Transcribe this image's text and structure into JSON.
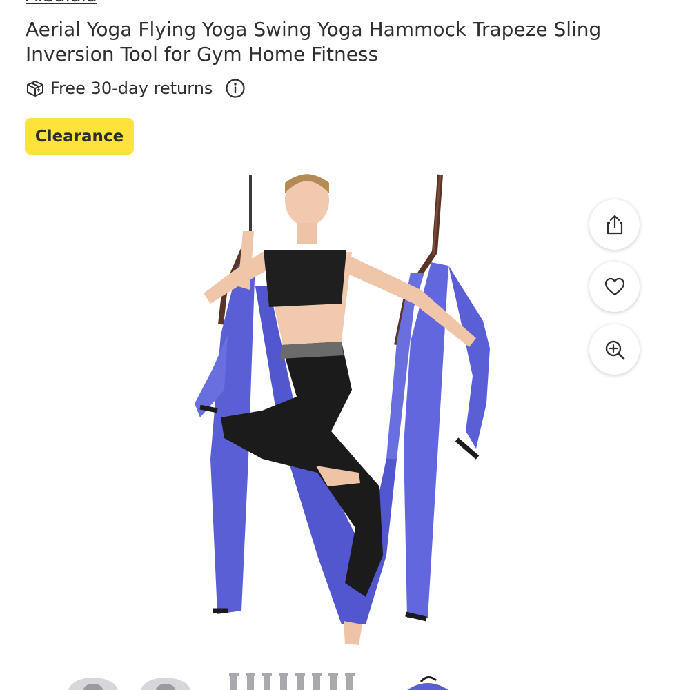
{
  "product": {
    "brand": "Aibaiaia",
    "title": "Aerial Yoga Flying Yoga Swing Yoga Hammock Trapeze Sling Inversion Tool for Gym Home Fitness",
    "returns_text": "Free 30-day returns",
    "badge_label": "Clearance"
  },
  "actions": {
    "share_icon": "share-icon",
    "favorite_icon": "heart-icon",
    "zoom_icon": "zoom-in-icon"
  },
  "colors": {
    "badge_bg": "#ffe33b",
    "text": "#2e2f32",
    "hammock": "#5b5fd6"
  }
}
